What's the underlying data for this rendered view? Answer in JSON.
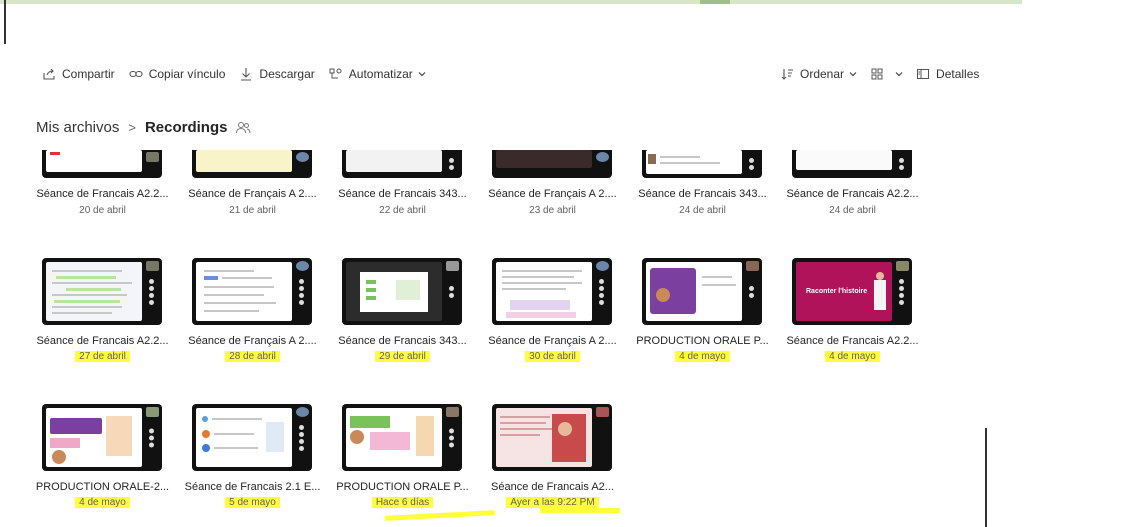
{
  "toolbar": {
    "share": "Compartir",
    "copy_link": "Copiar vínculo",
    "download": "Descargar",
    "automate": "Automatizar",
    "sort": "Ordenar",
    "details": "Detalles"
  },
  "breadcrumb": {
    "root": "Mis archivos",
    "separator": ">",
    "current": "Recordings"
  },
  "rows": [
    [
      {
        "title": "Séance de Francais A2.2...",
        "date": "20 de abril",
        "highlight": false
      },
      {
        "title": "Séance de Français A 2....",
        "date": "21 de abril",
        "highlight": false
      },
      {
        "title": "Séance de Francais 343...",
        "date": "22 de abril",
        "highlight": false
      },
      {
        "title": "Séance de Français A 2....",
        "date": "23 de abril",
        "highlight": false
      },
      {
        "title": "Séance de Francais 343...",
        "date": "24 de abril",
        "highlight": false
      },
      {
        "title": "Séance de Francais A2.2...",
        "date": "24 de abril",
        "highlight": false
      }
    ],
    [
      {
        "title": "Séance de Francais A2.2...",
        "date": "27 de abril",
        "highlight": true
      },
      {
        "title": "Séance de Français A 2....",
        "date": "28 de abril",
        "highlight": true
      },
      {
        "title": "Séance de Francais 343...",
        "date": "29 de abril",
        "highlight": true
      },
      {
        "title": "Séance de Français A 2....",
        "date": "30 de abril",
        "highlight": true
      },
      {
        "title": "PRODUCTION ORALE P...",
        "date": "4 de mayo",
        "highlight": true
      },
      {
        "title": "Séance de Francais A2.2...",
        "date": "4 de mayo",
        "highlight": true
      }
    ],
    [
      {
        "title": "PRODUCTION ORALE-2...",
        "date": "4 de mayo",
        "highlight": true
      },
      {
        "title": "Séance de Francais 2.1 E...",
        "date": "5 de mayo",
        "highlight": true
      },
      {
        "title": "PRODUCTION ORALE P...",
        "date": "Hace 6 días",
        "highlight": true
      },
      {
        "title": "Séance de Francais A2...",
        "date": "Ayer a las 9:22 PM",
        "highlight": true
      }
    ]
  ],
  "thumb_texts": {
    "raconter": "Raconter l'histoire"
  },
  "colors": {
    "highlight": "#ffff3a",
    "accent_pink": "#b0135a",
    "accent_purple": "#7b3fa0"
  }
}
